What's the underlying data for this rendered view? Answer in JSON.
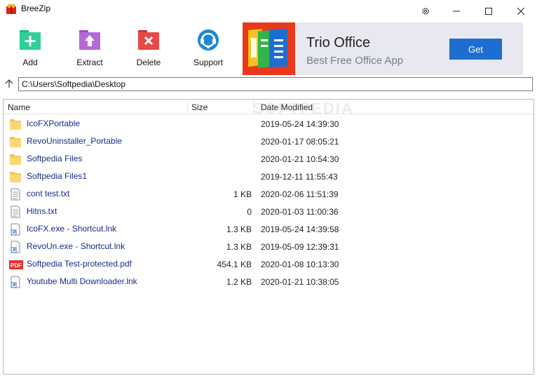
{
  "window": {
    "title": "BreeZip",
    "icons": [
      "settings-icon",
      "minimize-icon",
      "maximize-icon",
      "close-icon"
    ]
  },
  "toolbar": {
    "add_label": "Add",
    "extract_label": "Extract",
    "delete_label": "Delete",
    "support_label": "Support"
  },
  "ad": {
    "title": "Trio Office",
    "subtitle": "Best Free Office App",
    "button_label": "Get"
  },
  "path": {
    "value": "C:\\Users\\Softpedia\\Desktop"
  },
  "list": {
    "columns": [
      "Name",
      "Size",
      "Date Modified"
    ],
    "watermark": "SOFTPEDIA",
    "rows": [
      {
        "name": "IcoFXPortable",
        "size": "",
        "date": "2019-05-24 14:39:30",
        "icon": "folder-icon"
      },
      {
        "name": "RevoUninstaller_Portable",
        "size": "",
        "date": "2020-01-17 08:05:21",
        "icon": "folder-icon"
      },
      {
        "name": "Softpedia Files",
        "size": "",
        "date": "2020-01-21 10:54:30",
        "icon": "folder-icon"
      },
      {
        "name": "Softpedia Files1",
        "size": "",
        "date": "2019-12-11 11:55:43",
        "icon": "folder-icon"
      },
      {
        "name": "cont test.txt",
        "size": "1 KB",
        "date": "2020-02-06 11:51:39",
        "icon": "text-file-icon"
      },
      {
        "name": "Hitns.txt",
        "size": "0",
        "date": "2020-01-03 11:00:36",
        "icon": "text-file-icon"
      },
      {
        "name": "IcoFX.exe - Shortcut.lnk",
        "size": "1.3 KB",
        "date": "2019-05-24 14:39:58",
        "icon": "shortcut-icon"
      },
      {
        "name": "RevoUn.exe - Shortcut.lnk",
        "size": "1.3 KB",
        "date": "2019-05-09 12:39:31",
        "icon": "shortcut-icon"
      },
      {
        "name": "Softpedia Test-protected.pdf",
        "size": "454.1 KB",
        "date": "2020-01-08 10:13:30",
        "icon": "pdf-icon",
        "icon_text": "PDF"
      },
      {
        "name": "Youtube Multi Downloader.lnk",
        "size": "1.2 KB",
        "date": "2020-01-21 10:38:05",
        "icon": "shortcut-icon"
      }
    ]
  },
  "colors": {
    "add": "#2fcf98",
    "extract": "#b569d8",
    "delete": "#e84848",
    "support": "#1e88d6",
    "ad_button": "#1e6ed1",
    "ad_logo": "#e9391b",
    "ad_bg": "#e8e9f0",
    "file_name": "#1a2a88",
    "folder": "#fbd874"
  }
}
